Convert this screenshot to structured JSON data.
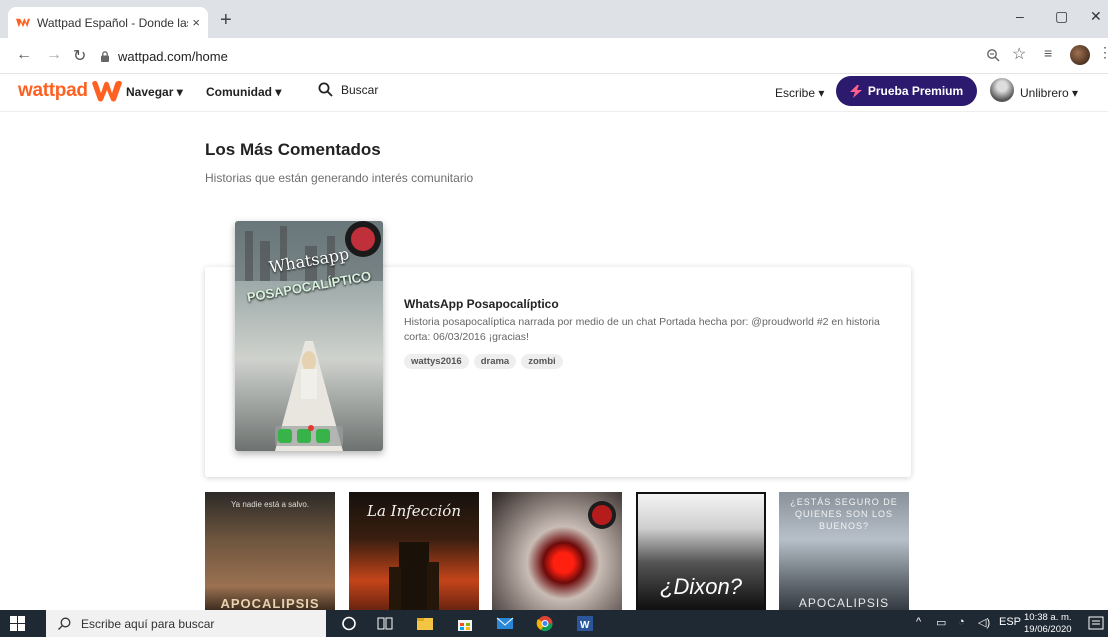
{
  "browser": {
    "tab_title": "Wattpad Español - Donde las his",
    "tab_close": "×",
    "new_tab": "+",
    "url": "wattpad.com/home",
    "min": "–",
    "restore": "▢",
    "close": "✕"
  },
  "header": {
    "logo": "wattpad",
    "nav_browse": "Navegar ▾",
    "nav_community": "Comunidad ▾",
    "search_label": "Buscar",
    "write": "Escribe ▾",
    "premium": "Prueba Premium",
    "username": "Unlibrero ▾"
  },
  "section": {
    "title": "Los Más Comentados",
    "subtitle": "Historias que están generando interés comunitario"
  },
  "featured": {
    "cover_title_line1": "Whatsapp",
    "cover_title_line2": "POSAPOCALÍPTICO",
    "title": "WhatsApp Posapocalíptico",
    "description": "Historia posapocalíptica narrada por medio de un chat Portada hecha por: @proudworld #2 en historia corta: 06/03/2016 ¡gracias!",
    "tags": [
      "wattys2016",
      "drama",
      "zombi"
    ]
  },
  "thumbs": {
    "t1_top": "Ya nadie está a salvo.",
    "t1_bottom": "APOCALIPSIS",
    "t2_title": "La Infección",
    "t4_title": "¿Dixon?",
    "t5_title": "¿ESTÁS SEGURO DE QUIENES SON LOS BUENOS?",
    "t5_bottom": "APOCALIPSIS"
  },
  "taskbar": {
    "search_placeholder": "Escribe aquí para buscar",
    "lang": "ESP",
    "time": "10:38 a. m.",
    "date": "19/06/2020"
  },
  "colors": {
    "brand_orange": "#ff6122",
    "premium_bg": "#2b1a6e"
  }
}
